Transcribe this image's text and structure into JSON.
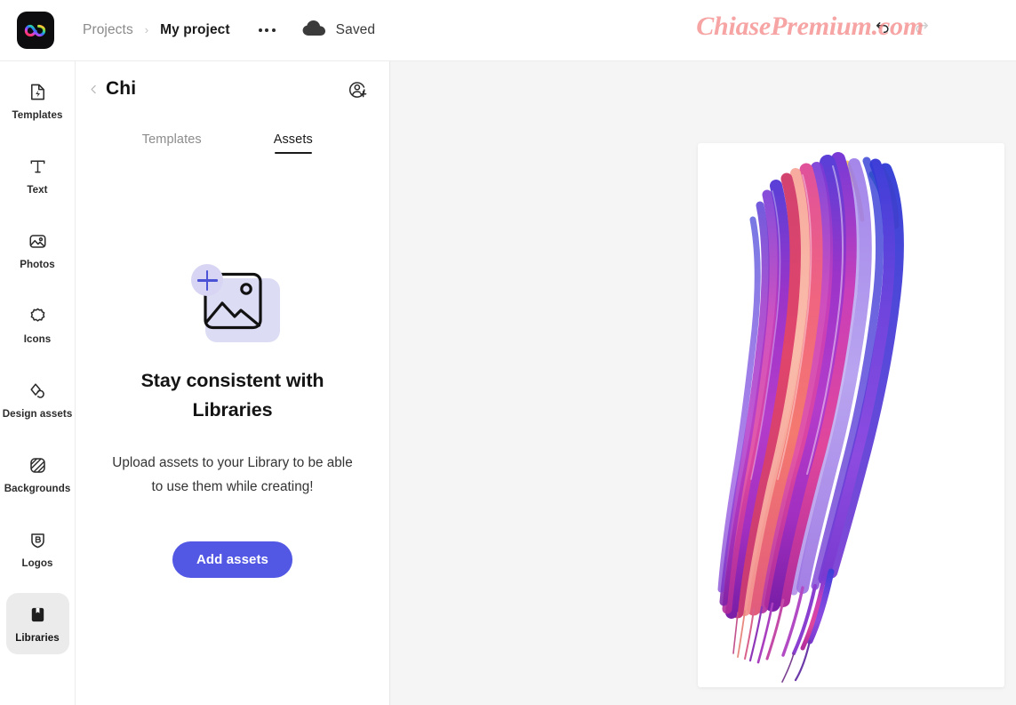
{
  "app": {
    "logo_icon": "adobe-express-logo",
    "accent_color": "#5258e4",
    "workspace_bg": "#f5f5f5"
  },
  "topbar": {
    "breadcrumb": {
      "root_label": "Projects",
      "separator": "›",
      "current_label": "My project"
    },
    "more_menu_icon": "more-horizontal-icon",
    "cloud_icon": "cloud-icon",
    "save_status": "Saved",
    "undo_icon": "undo-arrow-icon",
    "redo_icon": "redo-arrow-icon",
    "watermark": "ChiasePremium.com",
    "watermark_color": "#f48a8a"
  },
  "rail": {
    "items": [
      {
        "label": "Templates",
        "icon": "templates-icon",
        "active": false
      },
      {
        "label": "Text",
        "icon": "text-icon",
        "active": false
      },
      {
        "label": "Photos",
        "icon": "photos-icon",
        "active": false
      },
      {
        "label": "Icons",
        "icon": "icons-icon",
        "active": false
      },
      {
        "label": "Design assets",
        "icon": "design-assets-icon",
        "active": false
      },
      {
        "label": "Backgrounds",
        "icon": "backgrounds-icon",
        "active": false
      },
      {
        "label": "Logos",
        "icon": "logos-icon",
        "active": false
      },
      {
        "label": "Libraries",
        "icon": "libraries-icon",
        "active": true
      }
    ]
  },
  "panel": {
    "back_icon": "chevron-left-icon",
    "title": "Chi",
    "invite_icon": "add-person-icon",
    "tabs": [
      {
        "label": "Templates",
        "active": false
      },
      {
        "label": "Assets",
        "active": true
      }
    ],
    "empty_state": {
      "illustration_icon": "add-image-icon",
      "title": "Stay consistent with Libraries",
      "description": "Upload assets to your Library to be able to use them while creating!",
      "button_label": "Add assets"
    }
  },
  "canvas": {
    "artwork_name": "colorful-paint-brush-stroke"
  }
}
